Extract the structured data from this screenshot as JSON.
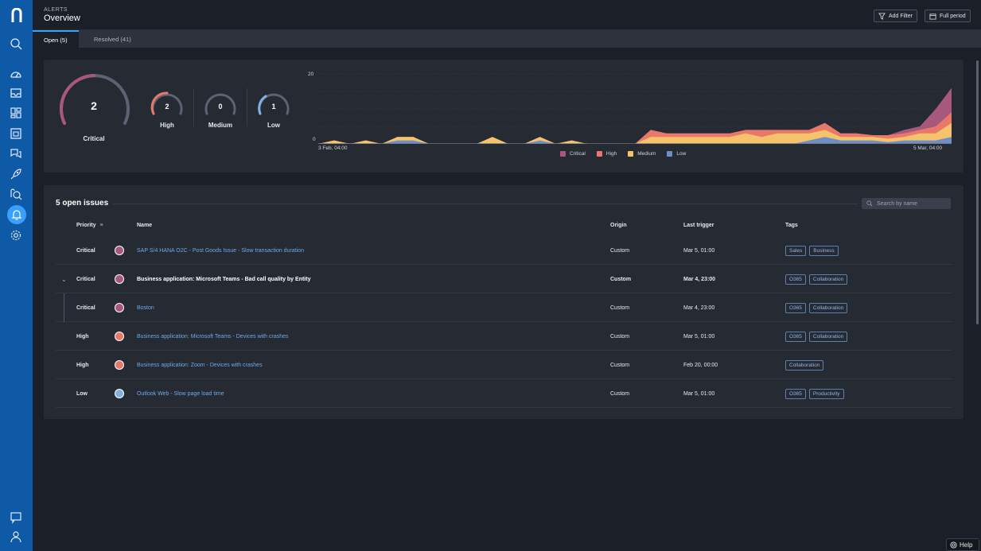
{
  "header": {
    "breadcrumb": "ALERTS",
    "title": "Overview",
    "add_filter_label": "Add Filter",
    "full_period_label": "Full period"
  },
  "tabs": [
    {
      "label": "Open (5)",
      "active": true
    },
    {
      "label": "Resolved (41)",
      "active": false
    }
  ],
  "summary": {
    "critical": {
      "count": "2",
      "label": "Critical",
      "color": "#a8587c"
    },
    "high": {
      "count": "2",
      "label": "High",
      "color": "#e8786a"
    },
    "medium": {
      "count": "0",
      "label": "Medium",
      "color": "#5b6272"
    },
    "low": {
      "count": "1",
      "label": "Low",
      "color": "#7fb2e0"
    }
  },
  "chart_data": {
    "type": "area",
    "title": "",
    "xlabel": "",
    "ylabel": "",
    "x_tick_labels": [
      "3 Feb, 04:00",
      "5 Mar, 04:00"
    ],
    "y_tick_labels": [
      "20",
      "0"
    ],
    "ylim": [
      0,
      20
    ],
    "grid": true,
    "legend_position": "bottom",
    "stacked": true,
    "x": [
      0,
      1,
      2,
      3,
      4,
      5,
      6,
      7,
      8,
      9,
      10,
      11,
      12,
      13,
      14,
      15,
      16,
      17,
      18,
      19,
      20,
      21,
      22,
      23,
      24,
      25,
      26,
      27,
      28,
      29,
      30,
      31,
      32,
      33,
      34,
      35,
      36,
      37,
      38,
      39,
      40
    ],
    "series": [
      {
        "name": "Low",
        "color": "#6d8fc4",
        "values": [
          0,
          0,
          0,
          0,
          0,
          1,
          1,
          0,
          0,
          0,
          0,
          0,
          0,
          0,
          1,
          0,
          0,
          0,
          0,
          0,
          0,
          0,
          0,
          0,
          0,
          0,
          0,
          0,
          0,
          0,
          0,
          1,
          2,
          1,
          1,
          1,
          0.5,
          1,
          1,
          1,
          2
        ]
      },
      {
        "name": "Medium",
        "color": "#f5c36b",
        "values": [
          0,
          1,
          0,
          1,
          0,
          1,
          1,
          0,
          0,
          0,
          0,
          2,
          0,
          0,
          1,
          0,
          1,
          0,
          0,
          0,
          0,
          2,
          2,
          2,
          2,
          2,
          2,
          3,
          2,
          3,
          3,
          2,
          2,
          1,
          1,
          1,
          1,
          1,
          2,
          2,
          4
        ]
      },
      {
        "name": "High",
        "color": "#e8786a",
        "values": [
          0,
          0,
          0,
          0,
          0,
          0,
          0,
          0,
          0,
          0,
          0,
          0,
          0,
          0,
          0,
          0,
          0,
          0,
          0,
          0,
          0,
          2,
          1,
          1,
          1,
          1,
          1,
          1,
          2,
          1,
          1,
          1,
          2,
          1,
          1,
          0.5,
          1,
          1,
          1,
          2,
          3
        ]
      },
      {
        "name": "Critical",
        "color": "#a8587c",
        "values": [
          0,
          0,
          0,
          0,
          0,
          0,
          0,
          0,
          0,
          0,
          0,
          0,
          0,
          0,
          0,
          0,
          0,
          0,
          0,
          0,
          0,
          0,
          0,
          0,
          0,
          0,
          0,
          0,
          0,
          0,
          0,
          0,
          0,
          0,
          0,
          0,
          0,
          1,
          1,
          5,
          7
        ]
      }
    ]
  },
  "legend": [
    {
      "label": "Critical",
      "color": "#a8587c"
    },
    {
      "label": "High",
      "color": "#e8786a"
    },
    {
      "label": "Medium",
      "color": "#f5c36b"
    },
    {
      "label": "Low",
      "color": "#6d8fc4"
    }
  ],
  "issues": {
    "title": "5 open issues",
    "search_placeholder": "Search by name",
    "columns": {
      "priority": "Priority",
      "name": "Name",
      "origin": "Origin",
      "last_trigger": "Last trigger",
      "tags": "Tags"
    },
    "rows": [
      {
        "priority": "Critical",
        "dot_color": "#a8587c",
        "name": "SAP S/4 HANA O2C - Post Goods Issue - Slow transaction duration",
        "origin": "Custom",
        "last_trigger": "Mar 5, 01:00",
        "tags": [
          "Sales",
          "Business"
        ],
        "group": false,
        "child": false
      },
      {
        "priority": "Critical",
        "dot_color": "#a8587c",
        "name": "Business application: Microsoft Teams - Bad call quality by Entity",
        "origin": "Custom",
        "last_trigger": "Mar 4, 23:00",
        "tags": [
          "O365",
          "Collaboration"
        ],
        "group": true,
        "child": false
      },
      {
        "priority": "Critical",
        "dot_color": "#a8587c",
        "name": "Boston",
        "origin": "Custom",
        "last_trigger": "Mar 4, 23:00",
        "tags": [
          "O365",
          "Collaboration"
        ],
        "group": false,
        "child": true
      },
      {
        "priority": "High",
        "dot_color": "#e8786a",
        "name": "Business application: Microsoft Teams - Devices with crashes",
        "origin": "Custom",
        "last_trigger": "Mar 5, 01:00",
        "tags": [
          "O365",
          "Collaboration"
        ],
        "group": false,
        "child": false
      },
      {
        "priority": "High",
        "dot_color": "#e8786a",
        "name": "Business application: Zoom - Devices with crashes",
        "origin": "Custom",
        "last_trigger": "Feb 20, 00:00",
        "tags": [
          "Collaboration"
        ],
        "group": false,
        "child": false
      },
      {
        "priority": "Low",
        "dot_color": "#7fb2e0",
        "name": "Outlook Web - Slow page load time",
        "origin": "Custom",
        "last_trigger": "Mar 5, 01:00",
        "tags": [
          "O365",
          "Productivity"
        ],
        "group": false,
        "child": false
      }
    ]
  },
  "help_label": "Help",
  "icons": [
    "nexthink-logo-icon",
    "search-icon",
    "gauge-icon",
    "inbox-icon",
    "dashboard-icon",
    "calendar-icon",
    "chat-icon",
    "rocket-icon",
    "investigate-icon",
    "bell-icon",
    "gear-icon",
    "feedback-icon",
    "user-icon"
  ]
}
